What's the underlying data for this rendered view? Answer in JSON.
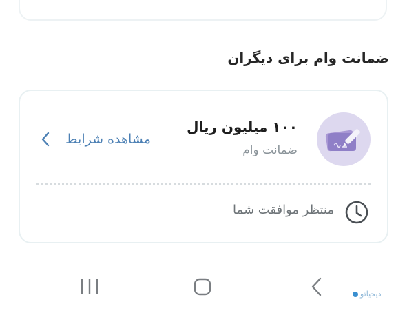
{
  "section": {
    "title": "ضمانت وام برای دیگران"
  },
  "loan_card": {
    "amount": "۱۰۰ میلیون ریال",
    "subtitle": "ضمانت وام",
    "terms_link": "مشاهده شرایط",
    "status": "منتظر موافقت شما",
    "icons": {
      "avatar": "contract-pen-icon",
      "status": "clock-icon",
      "link": "chevron-left-icon"
    }
  },
  "nav_bar": {
    "icons": [
      "recents-icon",
      "home-icon",
      "back-icon"
    ]
  },
  "watermark": {
    "text": "دیجیاتو"
  },
  "colors": {
    "link": "#4c80b4",
    "avatar_bg": "#ddd8ef",
    "card_border": "#e8f0f2"
  }
}
